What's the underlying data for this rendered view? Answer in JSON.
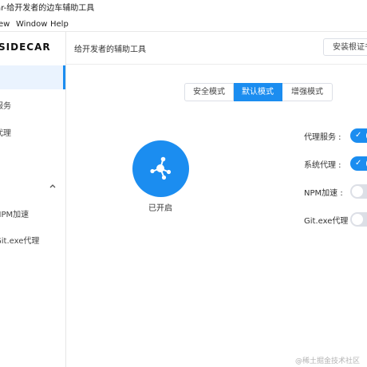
{
  "window": {
    "title": "ar-给开发者的边车辅助工具"
  },
  "menu": {
    "items": [
      "ew",
      "Window",
      "Help"
    ]
  },
  "sidebar": {
    "logo": "SIDECAR",
    "items": [
      {
        "label": "服务"
      },
      {
        "label": "代理"
      },
      {
        "label": "NPM加速"
      },
      {
        "label": "Git.exe代理"
      }
    ]
  },
  "header": {
    "title": "给开发者的辅助工具",
    "install_button": "安装根证书"
  },
  "modes": {
    "items": [
      "安全模式",
      "默认模式",
      "增强模式"
    ],
    "active": "默认模式"
  },
  "status": {
    "label": "已开启"
  },
  "settings": [
    {
      "label": "代理服务 :",
      "enabled": true
    },
    {
      "label": "系统代理 :",
      "enabled": true
    },
    {
      "label": "NPM加速 :",
      "enabled": false
    },
    {
      "label": "Git.exe代理",
      "enabled": false
    }
  ],
  "watermark": "@稀土掘金技术社区",
  "colors": {
    "primary": "#1b8df0",
    "switch_off": "#dcdfe6"
  },
  "icons": {
    "collapse": "chevron-up-icon",
    "status": "network-nodes-icon",
    "switch_on": "check-icon"
  }
}
